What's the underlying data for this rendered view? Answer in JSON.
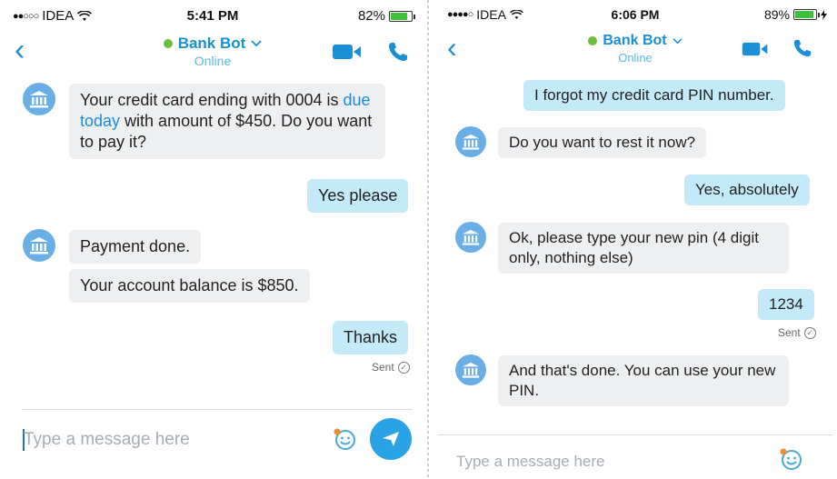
{
  "colors": {
    "accent": "#1a8fd6",
    "bot_bubble": "#edeff1",
    "user_bubble": "#c4e9f8",
    "online_dot": "#6cbf3c",
    "send_button": "#2aa3e6",
    "avatar": "#6aaee6"
  },
  "left": {
    "status": {
      "carrier": "IDEA",
      "signal": "●●○○○",
      "time": "5:41 PM",
      "battery": "82%",
      "battery_level": 0.82
    },
    "header": {
      "title": "Bank Bot",
      "subtitle": "Online"
    },
    "messages": {
      "m1_a": "Your credit card ending with 0004 is ",
      "m1_link": "due today",
      "m1_b": " with amount of $450. Do you want to pay it?",
      "m2": "Yes please",
      "m3": "Payment done.",
      "m4": "Your account balance is $850.",
      "m5": "Thanks"
    },
    "sent_label": "Sent",
    "compose": {
      "placeholder": "Type a message here"
    }
  },
  "right": {
    "status": {
      "carrier": "IDEA",
      "signal": "●●●●○",
      "time": "6:06 PM",
      "battery": "89%",
      "battery_level": 0.89
    },
    "header": {
      "title": "Bank Bot",
      "subtitle": "Online"
    },
    "messages": {
      "m1": "I forgot my credit card PIN number.",
      "m2": "Do you want to rest it now?",
      "m3": "Yes, absolutely",
      "m4": "Ok, please type your new pin (4 digit only, nothing else)",
      "m5": "1234",
      "m6": "And that's done. You can use your new PIN."
    },
    "sent_label": "Sent",
    "compose": {
      "placeholder": "Type a message here"
    }
  }
}
